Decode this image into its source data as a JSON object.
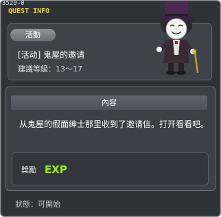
{
  "window": {
    "quest_id": "3529-0",
    "title": "QUEST INFO"
  },
  "quest": {
    "category_badge": "活動",
    "name": "[活动] 鬼屋的邀请",
    "level_label": "建議等級：",
    "level_range": "13〜17"
  },
  "content": {
    "section_title": "內容",
    "description": "从鬼屋的假面绅士那里收到了邀请信。打开看看吧。"
  },
  "reward": {
    "label": "獎勵",
    "icon": "exp-icon",
    "icon_text": "EXP"
  },
  "status": {
    "label": "狀態：",
    "value": "可開始"
  },
  "colors": {
    "title_yellow": "#f2d12e",
    "panel_bg": "#3d4349",
    "exp_green": "#9ee22a"
  },
  "npc": {
    "icon": "masked-gentleman-npc-icon"
  }
}
